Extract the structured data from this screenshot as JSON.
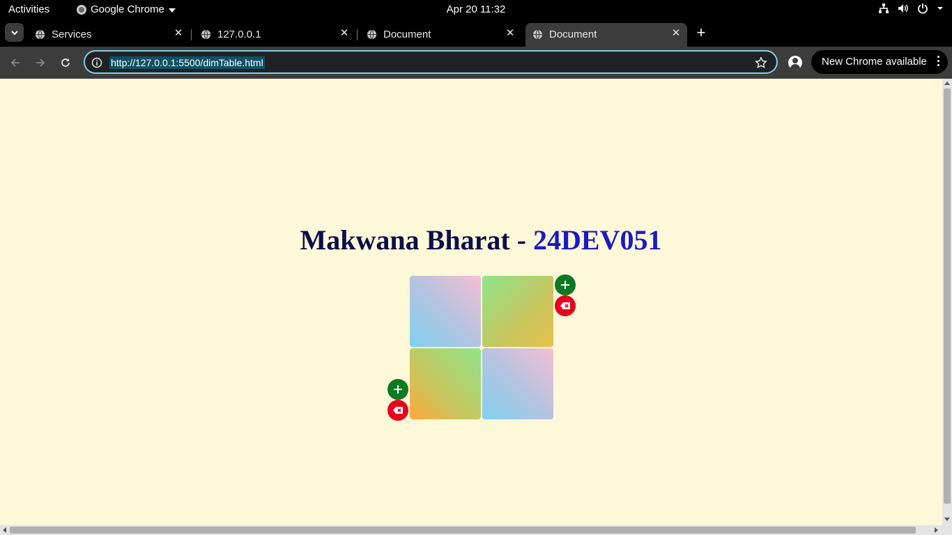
{
  "system_bar": {
    "activities": "Activities",
    "app_name": "Google Chrome",
    "clock": "Apr 20  11:32",
    "tray_icons": [
      "network-icon",
      "volume-icon",
      "power-icon"
    ]
  },
  "tabs": [
    {
      "label": "Services",
      "active": false
    },
    {
      "label": "127.0.0.1",
      "active": false
    },
    {
      "label": "Document",
      "active": false
    },
    {
      "label": "Document",
      "active": true
    }
  ],
  "toolbar": {
    "url": "http://127.0.0.1:5500/dimTable.html",
    "update_label": "New Chrome available"
  },
  "page": {
    "title_name": "Makwana Bharat - ",
    "title_id": "24DEV051",
    "background": "#fcf8d8",
    "add_button_color": "#0c7a22",
    "delete_button_color": "#e8001c"
  }
}
